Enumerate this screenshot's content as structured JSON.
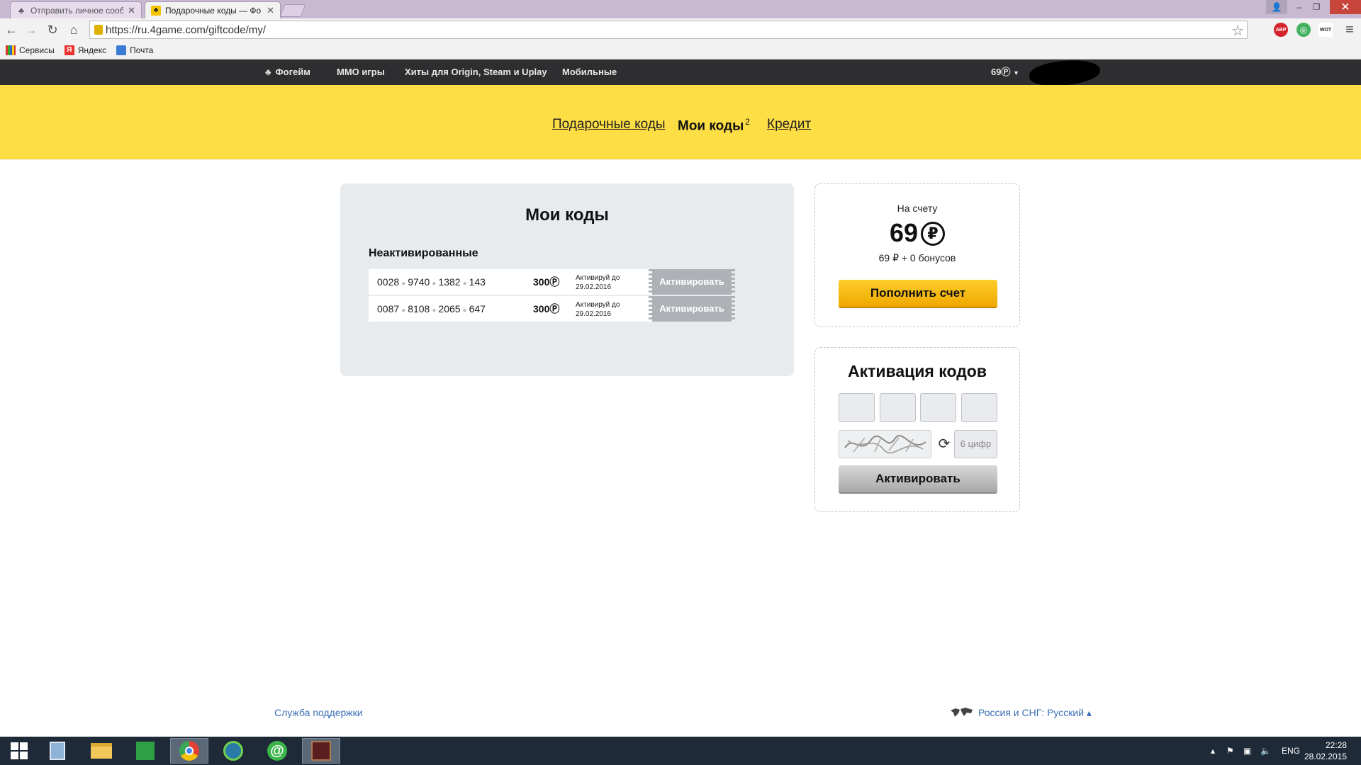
{
  "browser": {
    "tabs": [
      {
        "title": "Отправить личное сообщ",
        "active": false
      },
      {
        "title": "Подарочные коды — Фо",
        "active": true
      }
    ],
    "url": "https://ru.4game.com/giftcode/my/",
    "bookmarks": [
      "Сервисы",
      "Яндекс",
      "Почта"
    ],
    "extensions": [
      "ABP",
      "WOT"
    ]
  },
  "site_nav": {
    "items": [
      "Фогейм",
      "MMO игры",
      "Хиты для Origin, Steam и Uplay",
      "Мобильные"
    ],
    "balance": "69"
  },
  "subnav": {
    "gift_codes": "Подарочные коды",
    "my_codes": "Мои коды",
    "my_codes_count": "2",
    "credit": "Кредит"
  },
  "codes": {
    "title": "Мои коды",
    "section": "Неактивированные",
    "currency_glyph": "₽",
    "activate_label": "Активировать",
    "expiry_label": "Активируй до",
    "items": [
      {
        "parts": [
          "0028",
          "9740",
          "1382",
          "143"
        ],
        "value": "300",
        "expires": "29.02.2016"
      },
      {
        "parts": [
          "0087",
          "8108",
          "2065",
          "647"
        ],
        "value": "300",
        "expires": "29.02.2016"
      }
    ]
  },
  "balance_card": {
    "label": "На счету",
    "amount": "69",
    "detail": "69 ₽  + 0 бонусов",
    "topup_button": "Пополнить счет"
  },
  "activation": {
    "title": "Активация кодов",
    "captcha_placeholder": "6 цифр",
    "button": "Активировать"
  },
  "footer": {
    "support": "Служба поддержки",
    "region": "Россия и СНГ: Русский ▴"
  },
  "taskbar": {
    "language": "ENG",
    "time": "22:28",
    "date": "28.02.2015"
  },
  "colors": {
    "accent_yellow": "#fede45",
    "topbar": "#2e2e30",
    "link": "#3b6fb6"
  }
}
